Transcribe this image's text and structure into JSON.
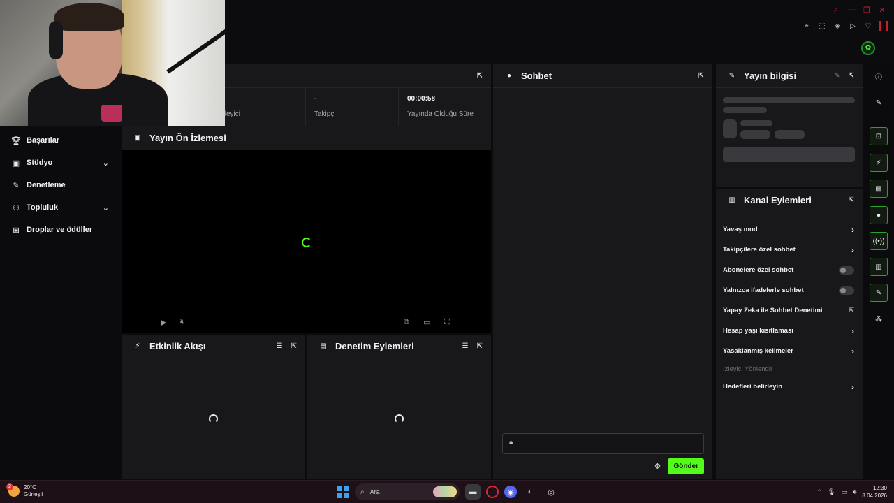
{
  "sidebar": {
    "items": [
      {
        "label": "Başarılar",
        "icon": "trophy-icon"
      },
      {
        "label": "Stüdyo",
        "icon": "studio-icon"
      },
      {
        "label": "Denetleme",
        "icon": "wrench-icon"
      },
      {
        "label": "Topluluk",
        "icon": "community-icon"
      },
      {
        "label": "Droplar ve ödüller",
        "icon": "gift-icon"
      }
    ]
  },
  "stats": {
    "viewers_label": "İzleyici",
    "followers_value": "-",
    "followers_label": "Takipçi",
    "uptime_value": "00:00:58",
    "uptime_label": "Yayında Olduğu Süre"
  },
  "preview": {
    "title": "Yayın Ön İzlemesi"
  },
  "activity": {
    "title": "Etkinlik Akışı"
  },
  "modactions": {
    "title": "Denetim Eylemleri"
  },
  "chat": {
    "title": "Sohbet",
    "send_label": "Gönder"
  },
  "info": {
    "title": "Yayın bilgisi"
  },
  "actions": {
    "title": "Kanal Eylemleri",
    "items": [
      {
        "label": "Yavaş mod",
        "control": "chevron"
      },
      {
        "label": "Takipçilere özel sohbet",
        "control": "chevron"
      },
      {
        "label": "Abonelere özel sohbet",
        "control": "toggle"
      },
      {
        "label": "Yalnızca ifadelerle sohbet",
        "control": "toggle"
      },
      {
        "label": "Yapay Zeka ile Sohbet Denetimi",
        "control": "external"
      },
      {
        "label": "Hesap yaşı kısıtlaması",
        "control": "chevron"
      },
      {
        "label": "Yasaklanmış kelimeler",
        "control": "chevron"
      },
      {
        "label": "İzleyici Yönlendir",
        "control": "disabled"
      },
      {
        "label": "Hedefleri belirleyin",
        "control": "chevron"
      }
    ]
  },
  "taskbar": {
    "temperature": "20°C",
    "weather": "Güneşli",
    "weather_badge": "2",
    "search_placeholder": "Ara",
    "time": "12:30",
    "date": "8.04.2026"
  },
  "colors": {
    "accent": "#53fc18",
    "panel": "#18181b",
    "background": "#0b0b0d"
  }
}
